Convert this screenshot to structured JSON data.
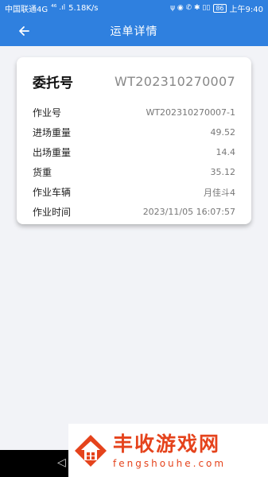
{
  "status_bar": {
    "carrier": "中国联通4G",
    "signal": "⁴⁶ .ıl",
    "speed": "5.18K/s",
    "icons": "ψ ◉ ✆ ✱ ▯▯",
    "battery": "86",
    "time": "上午9:40"
  },
  "app_bar": {
    "title": "运单详情"
  },
  "card": {
    "head_label": "委托号",
    "head_value": "WT202310270007",
    "rows": [
      {
        "label": "作业号",
        "value": "WT202310270007-1"
      },
      {
        "label": "进场重量",
        "value": "49.52"
      },
      {
        "label": "出场重量",
        "value": "14.4"
      },
      {
        "label": "货重",
        "value": "35.12"
      },
      {
        "label": "作业车辆",
        "value": "月佳斗4"
      },
      {
        "label": "作业时间",
        "value": "2023/11/05 16:07:57"
      }
    ]
  },
  "nav_bar": {
    "back_glyph": "◁"
  },
  "watermark": {
    "name_cn": "丰收游戏网",
    "name_en": "fengshouhe.com"
  },
  "colors": {
    "primary": "#2f80df",
    "background": "#f2f3f7",
    "watermark": "#e5431c"
  }
}
